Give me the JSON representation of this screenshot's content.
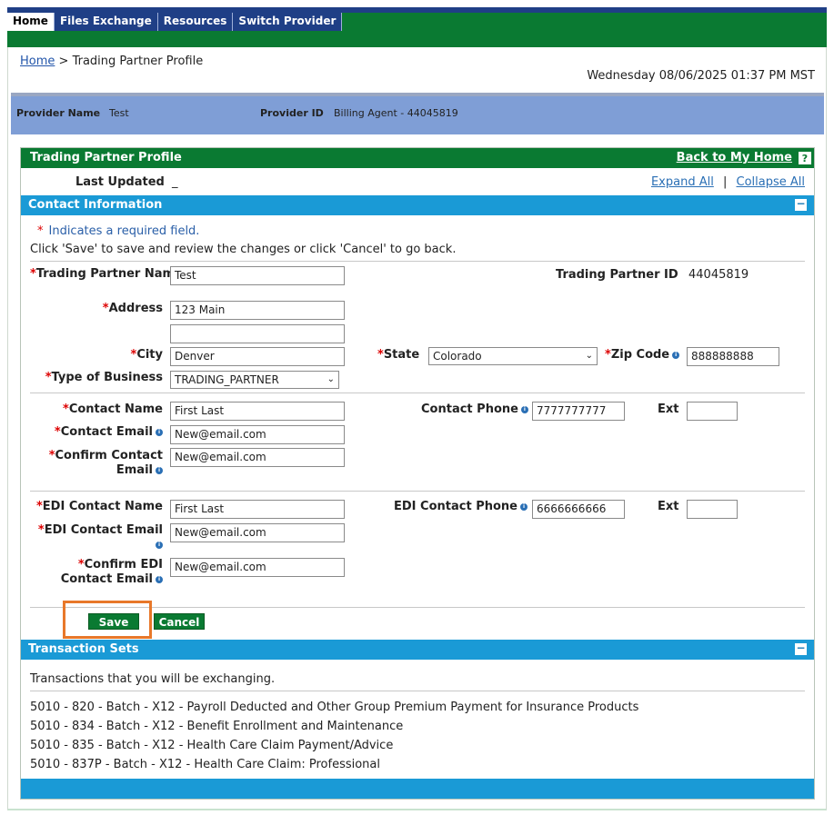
{
  "nav": {
    "tabs": [
      {
        "label": "Home"
      },
      {
        "label": "Files Exchange"
      },
      {
        "label": "Resources"
      },
      {
        "label": "Switch Provider"
      }
    ]
  },
  "breadcrumb": {
    "home": "Home",
    "separator": ">",
    "current": "Trading Partner Profile"
  },
  "datetime": "Wednesday 08/06/2025 01:37 PM MST",
  "provider": {
    "name_label": "Provider Name",
    "name_value": "Test",
    "id_label": "Provider ID",
    "id_value": "Billing Agent - 44045819"
  },
  "panel": {
    "title": "Trading Partner Profile",
    "back_link": "Back to My Home",
    "help_icon": "?",
    "last_updated_label": "Last Updated",
    "last_updated_value": "_",
    "expand_all": "Expand All",
    "separator": "|",
    "collapse_all": "Collapse All"
  },
  "contact": {
    "section_title": "Contact Information",
    "collapse_icon": "−",
    "required_star": "*",
    "required_note": "Indicates a required field.",
    "instruction": "Click 'Save' to save and review the changes or click 'Cancel' to go back.",
    "trading_partner_name_label": "Trading Partner Name",
    "trading_partner_name_value": "Test",
    "trading_partner_id_label": "Trading Partner ID",
    "trading_partner_id_value": "44045819",
    "address_label": "Address",
    "address1_value": "123 Main",
    "address2_value": "",
    "city_label": "City",
    "city_value": "Denver",
    "state_label": "State",
    "state_value": "Colorado",
    "zip_label": "Zip Code",
    "zip_value": "888888888",
    "business_type_label": "Type of Business",
    "business_type_value": "TRADING_PARTNER",
    "contact_name_label": "Contact Name",
    "contact_name_value": "First Last",
    "contact_phone_label": "Contact Phone",
    "contact_phone_value": "7777777777",
    "ext_label": "Ext",
    "contact_ext_value": "",
    "contact_email_label": "Contact Email",
    "contact_email_value": "New@email.com",
    "confirm_contact_email_label_1": "Confirm Contact",
    "confirm_contact_email_label_2": "Email",
    "confirm_contact_email_value": "New@email.com",
    "edi_contact_name_label": "EDI Contact Name",
    "edi_contact_name_value": "First Last",
    "edi_contact_phone_label": "EDI Contact Phone",
    "edi_contact_phone_value": "6666666666",
    "edi_ext_value": "",
    "edi_contact_email_label": "EDI Contact Email",
    "edi_contact_email_value": "New@email.com",
    "confirm_edi_email_label_1": "Confirm EDI",
    "confirm_edi_email_label_2": "Contact Email",
    "confirm_edi_email_value": "New@email.com",
    "save_label": "Save",
    "cancel_label": "Cancel"
  },
  "transactions": {
    "section_title": "Transaction Sets",
    "collapse_icon": "−",
    "intro": "Transactions that you will be exchanging.",
    "items": [
      "5010 - 820 - Batch - X12 - Payroll Deducted and Other Group Premium Payment for Insurance Products",
      "5010 - 834 - Batch - X12 - Benefit Enrollment and Maintenance",
      "5010 - 835 - Batch - X12 - Health Care Claim Payment/Advice",
      "5010 - 837P - Batch - X12 - Health Care Claim: Professional"
    ]
  },
  "colors": {
    "nav_green": "#0a7a32",
    "nav_blue": "#1f3f86",
    "section_blue": "#1a9ad6",
    "provider_bar": "#7f9ed6",
    "required_red": "#dd0000",
    "highlight_orange": "#e8782a"
  }
}
